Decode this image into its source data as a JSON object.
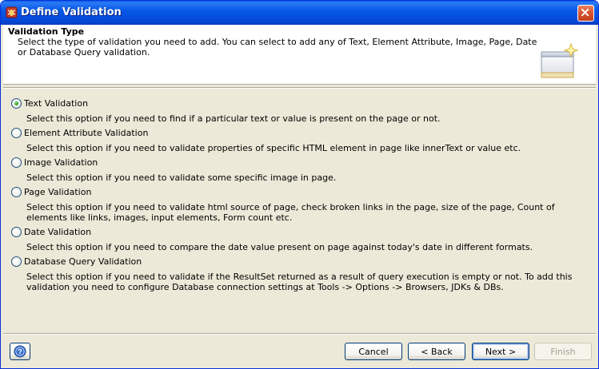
{
  "window": {
    "title": "Define Validation",
    "close_icon": "close-icon",
    "app_icon": "app-bug-icon"
  },
  "header": {
    "title": "Validation Type",
    "description": "Select the type of validation you need to add. You can select to add any of Text, Element Attribute, Image, Page, Date or Database Query validation.",
    "icon": "wizard-window-icon"
  },
  "options": [
    {
      "label": "Text Validation",
      "selected": true,
      "description": "Select this option if you need to find if a particular text or value is present on the page or not."
    },
    {
      "label": "Element Attribute Validation",
      "selected": false,
      "description": "Select this option if you need to validate properties of specific HTML element in page like innerText or value etc."
    },
    {
      "label": "Image Validation",
      "selected": false,
      "description": "Select this option if you need to validate some specific image in page."
    },
    {
      "label": "Page Validation",
      "selected": false,
      "description": "Select this option if you need to validate html source of page, check broken links in the page, size of the page, Count of elements like links, images, input elements, Form count etc."
    },
    {
      "label": "Date Validation",
      "selected": false,
      "description": "Select this option if you need to compare the date value present on page against today's date in different formats."
    },
    {
      "label": "Database Query Validation",
      "selected": false,
      "description": "Select this option if you need to validate if the ResultSet returned as a result of query execution is empty or not. To add this validation you need to configure Database connection settings at Tools -> Options -> Browsers, JDKs & DBs."
    }
  ],
  "footer": {
    "help_icon": "help-icon",
    "cancel_label": "Cancel",
    "back_label": "< Back",
    "next_label": "Next >",
    "finish_label": "Finish"
  }
}
